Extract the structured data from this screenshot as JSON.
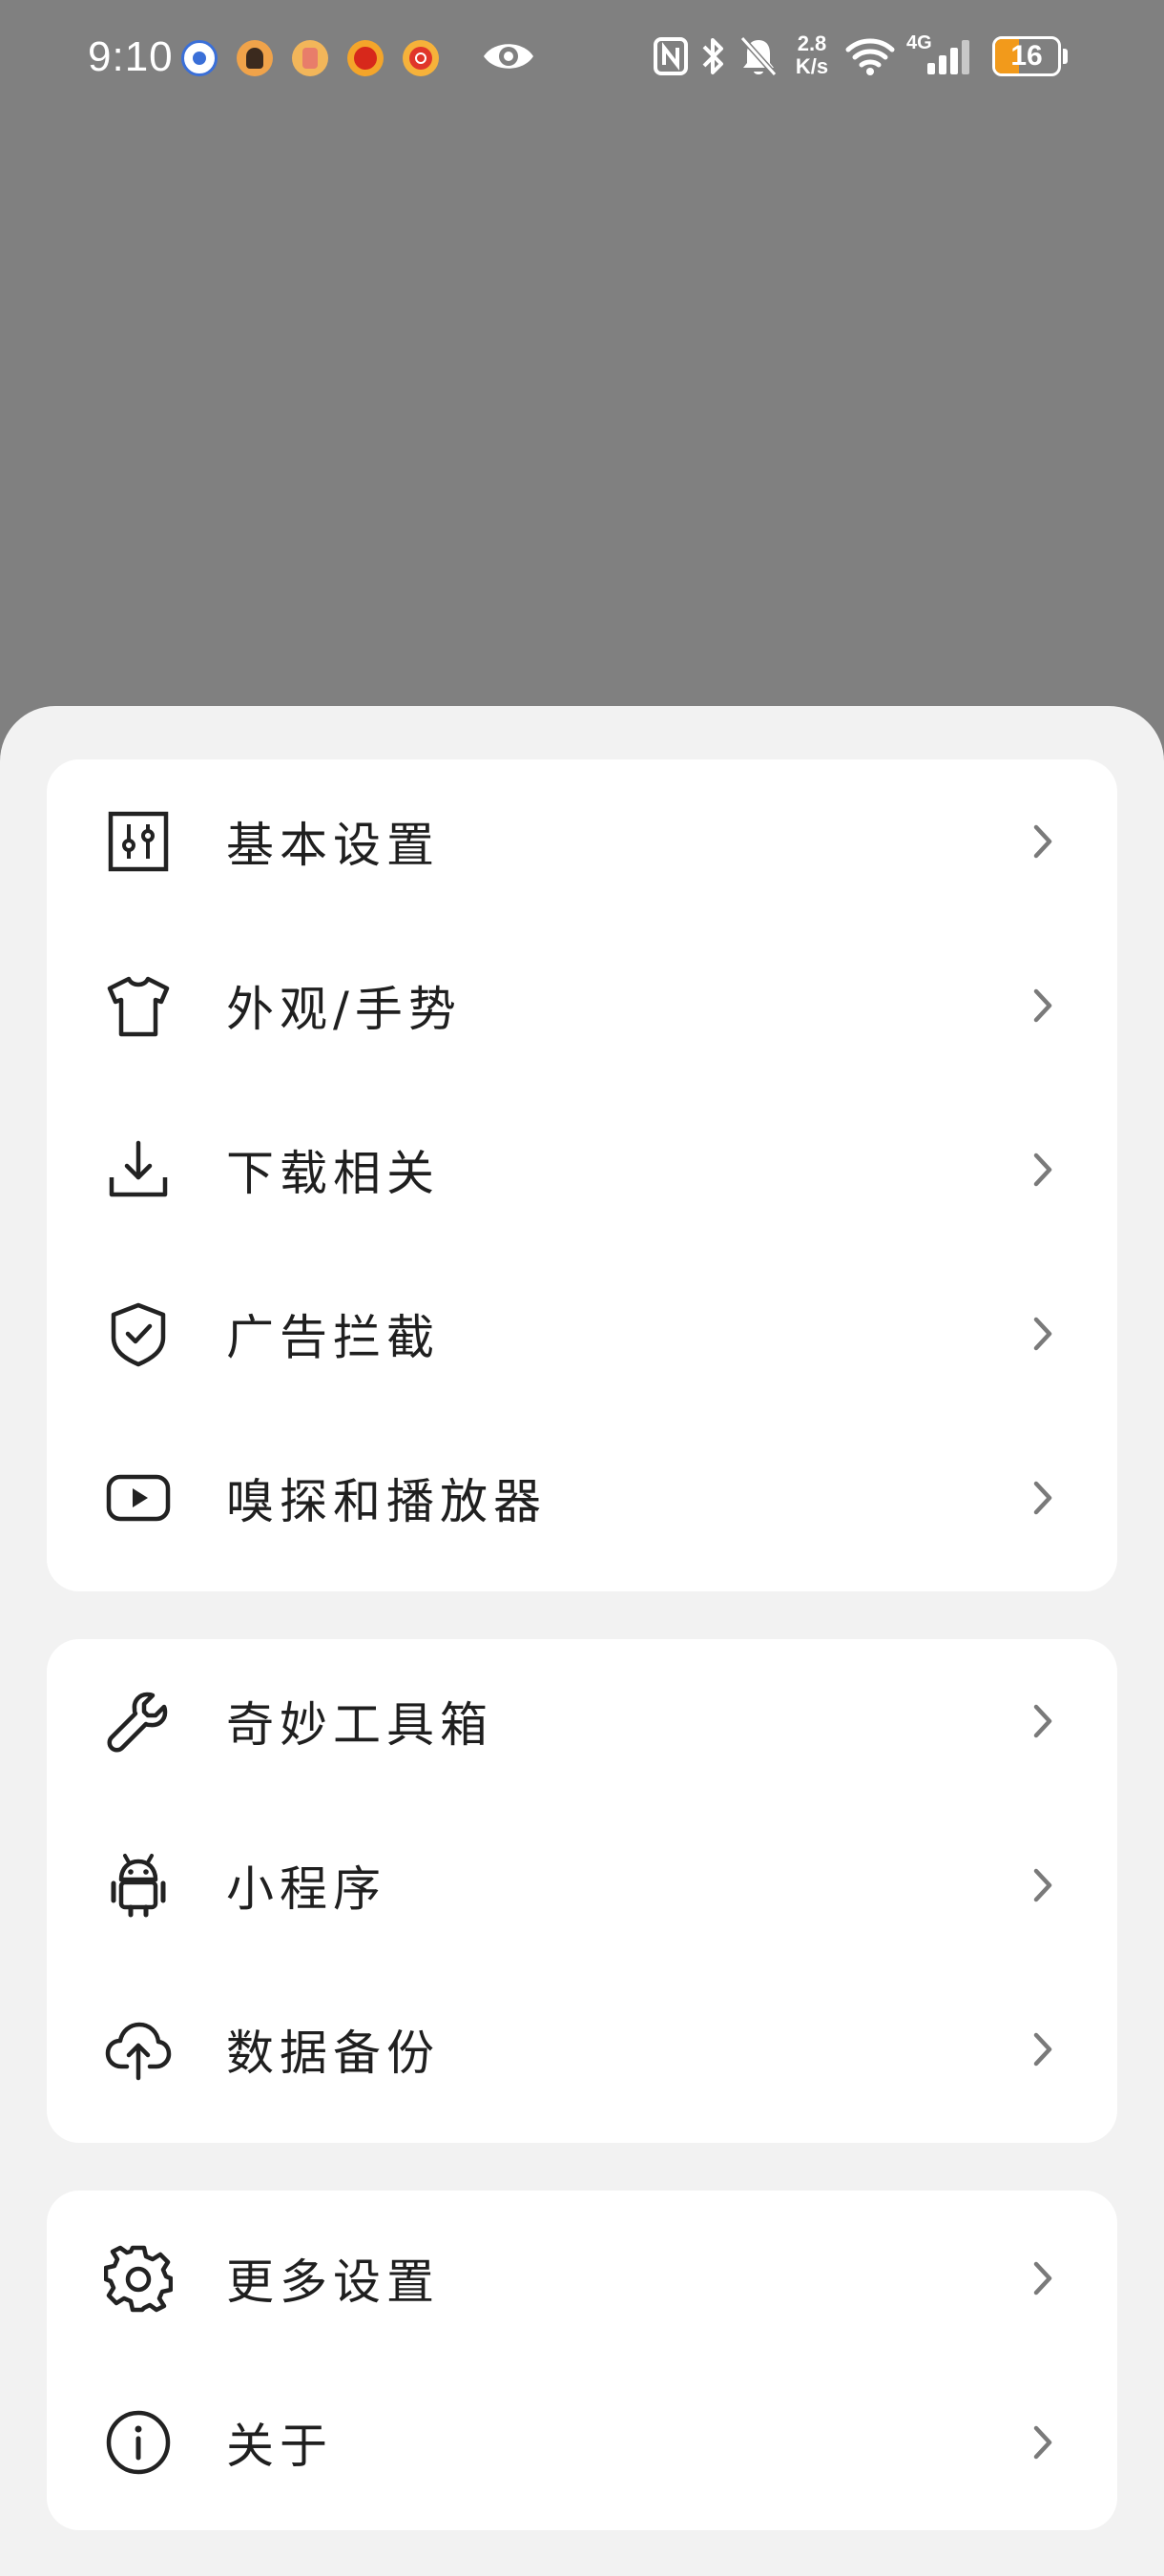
{
  "status_bar": {
    "time": "9:10",
    "net_speed_value": "2.8",
    "net_speed_unit": "K/s",
    "network_type": "4G",
    "battery": "16",
    "battery_level_percent": 16,
    "icons": [
      "notification-icon",
      "eye-icon",
      "nfc-icon",
      "bluetooth-icon",
      "bell-off-icon",
      "wifi-icon",
      "signal-icon",
      "battery-icon"
    ]
  },
  "colors": {
    "overlay": "#808080",
    "sheet_background": "#f2f2f2",
    "card_background": "#ffffff",
    "text": "#1f1f1f",
    "chevron": "#7a7a7a",
    "battery_fill": "#f29a1b"
  },
  "groups": [
    {
      "items": [
        {
          "label": "基本设置",
          "icon": "sliders-icon"
        },
        {
          "label": "外观/手势",
          "icon": "tshirt-icon"
        },
        {
          "label": "下载相关",
          "icon": "download-icon"
        },
        {
          "label": "广告拦截",
          "icon": "shield-check-icon"
        },
        {
          "label": "嗅探和播放器",
          "icon": "play-icon"
        }
      ]
    },
    {
      "items": [
        {
          "label": "奇妙工具箱",
          "icon": "wrench-icon"
        },
        {
          "label": "小程序",
          "icon": "android-icon"
        },
        {
          "label": "数据备份",
          "icon": "cloud-upload-icon"
        }
      ]
    },
    {
      "items": [
        {
          "label": "更多设置",
          "icon": "gear-icon"
        },
        {
          "label": "关于",
          "icon": "info-icon"
        }
      ]
    }
  ]
}
